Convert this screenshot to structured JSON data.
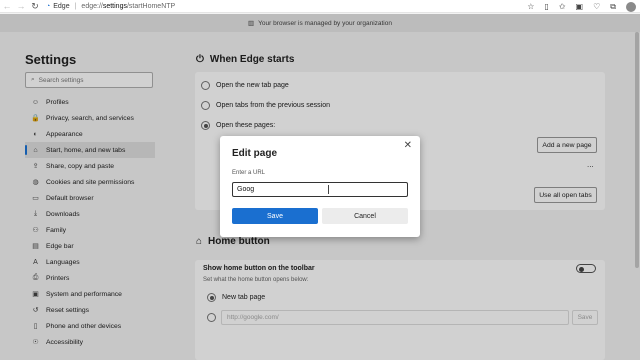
{
  "browser": {
    "app_name": "Edge",
    "url_prefix": "edge://",
    "url_bold": "settings",
    "url_rest": "/startHomeNTP"
  },
  "banner": {
    "text": "Your browser is managed by your organization"
  },
  "sidebar": {
    "title": "Settings",
    "search_placeholder": "Search settings",
    "items": [
      {
        "label": "Profiles",
        "icon": "profile-icon"
      },
      {
        "label": "Privacy, search, and services",
        "icon": "lock-icon"
      },
      {
        "label": "Appearance",
        "icon": "appearance-icon"
      },
      {
        "label": "Start, home, and new tabs",
        "icon": "home-icon",
        "active": true
      },
      {
        "label": "Share, copy and paste",
        "icon": "share-icon"
      },
      {
        "label": "Cookies and site permissions",
        "icon": "cookie-icon"
      },
      {
        "label": "Default browser",
        "icon": "browser-icon"
      },
      {
        "label": "Downloads",
        "icon": "download-icon"
      },
      {
        "label": "Family",
        "icon": "family-icon"
      },
      {
        "label": "Edge bar",
        "icon": "edgebar-icon"
      },
      {
        "label": "Languages",
        "icon": "language-icon"
      },
      {
        "label": "Printers",
        "icon": "printer-icon"
      },
      {
        "label": "System and performance",
        "icon": "system-icon"
      },
      {
        "label": "Reset settings",
        "icon": "reset-icon"
      },
      {
        "label": "Phone and other devices",
        "icon": "phone-icon"
      },
      {
        "label": "Accessibility",
        "icon": "accessibility-icon"
      }
    ]
  },
  "when_edge_starts": {
    "title": "When Edge starts",
    "options": [
      {
        "label": "Open the new tab page",
        "selected": false
      },
      {
        "label": "Open tabs from the previous session",
        "selected": false
      },
      {
        "label": "Open these pages:",
        "selected": true
      }
    ],
    "add_page_button": "Add a new page",
    "more_label": "...",
    "use_all_tabs_button": "Use all open tabs"
  },
  "home_button": {
    "title": "Home button",
    "toggle_label": "Show home button on the toolbar",
    "description": "Set what the home button opens below:",
    "option_new_tab": "New tab page",
    "url_placeholder": "http://google.com/",
    "save_label": "Save"
  },
  "dialog": {
    "title": "Edit page",
    "close_glyph": "✕",
    "field_label": "Enter a URL",
    "field_value": "Goog",
    "save_button": "Save",
    "cancel_button": "Cancel"
  },
  "colors": {
    "accent": "#1a6fd0",
    "banner_bg": "#e6e6e6"
  }
}
